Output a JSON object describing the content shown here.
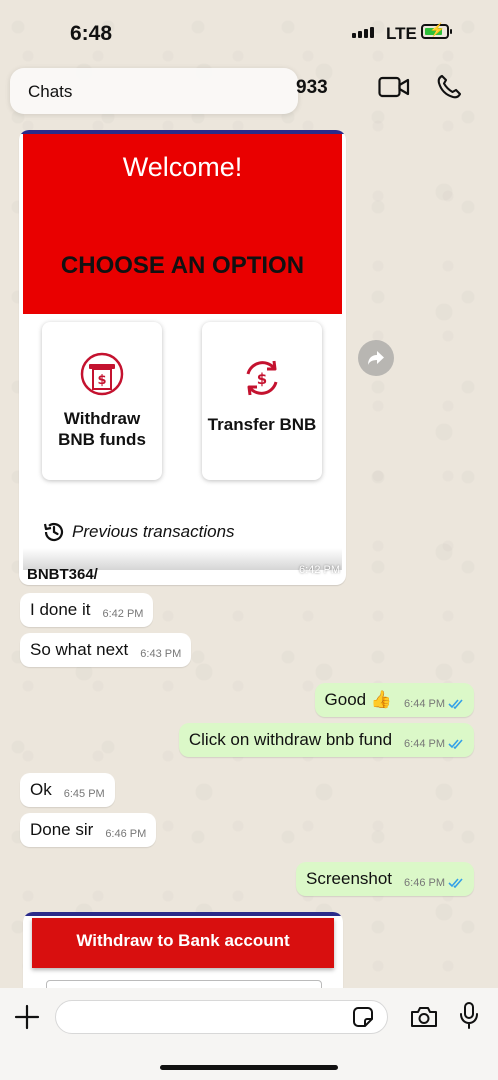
{
  "status_bar": {
    "time": "6:48",
    "network": "LTE"
  },
  "header": {
    "back_label": "Chats",
    "contact_peek": "933"
  },
  "card": {
    "welcome": "Welcome!",
    "choose": "CHOOSE AN OPTION",
    "option_1": "Withdraw\nBNB funds",
    "option_2": "Transfer BNB",
    "previous": "Previous transactions",
    "caption": "BNBT364/",
    "time": "6:42 PM"
  },
  "messages": [
    {
      "dir": "in",
      "text": "I done it",
      "time": "6:42 PM"
    },
    {
      "dir": "in",
      "text": "So what next",
      "time": "6:43 PM"
    },
    {
      "dir": "out",
      "text": "Good 👍",
      "time": "6:44 PM"
    },
    {
      "dir": "out",
      "text": "Click on withdraw bnb fund",
      "time": "6:44 PM"
    },
    {
      "dir": "in",
      "text": "Ok",
      "time": "6:45 PM"
    },
    {
      "dir": "in",
      "text": "Done sir",
      "time": "6:46 PM"
    },
    {
      "dir": "out",
      "text": "Screenshot",
      "time": "6:46 PM"
    }
  ],
  "card2": {
    "title": "Withdraw to Bank account"
  },
  "composer": {
    "placeholder": ""
  },
  "colors": {
    "card_red": "#e90000",
    "outgoing_bubble": "#dbf8c8",
    "tick_blue": "#34a0e8"
  },
  "icons": [
    "video-icon",
    "phone-icon",
    "atm-icon",
    "exchange-icon",
    "history-icon",
    "forward-icon",
    "plus-icon",
    "sticker-icon",
    "camera-icon",
    "mic-icon"
  ]
}
